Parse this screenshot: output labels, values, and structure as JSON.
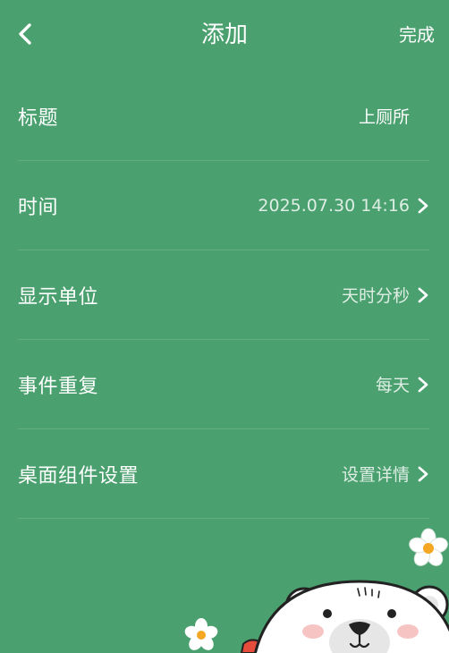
{
  "header": {
    "title": "添加",
    "done_label": "完成"
  },
  "rows": [
    {
      "label": "标题",
      "value": "上厕所",
      "chevron": false
    },
    {
      "label": "时间",
      "value": "2025.07.30 14:16",
      "chevron": true
    },
    {
      "label": "显示单位",
      "value": "天时分秒",
      "chevron": true
    },
    {
      "label": "事件重复",
      "value": "每天",
      "chevron": true
    },
    {
      "label": "桌面组件设置",
      "value": "设置详情",
      "chevron": true
    }
  ],
  "colors": {
    "background": "#4aa06e",
    "text": "#ffffff"
  },
  "icons": {
    "back": "chevron-left-icon",
    "row_arrow": "chevron-right-icon"
  }
}
